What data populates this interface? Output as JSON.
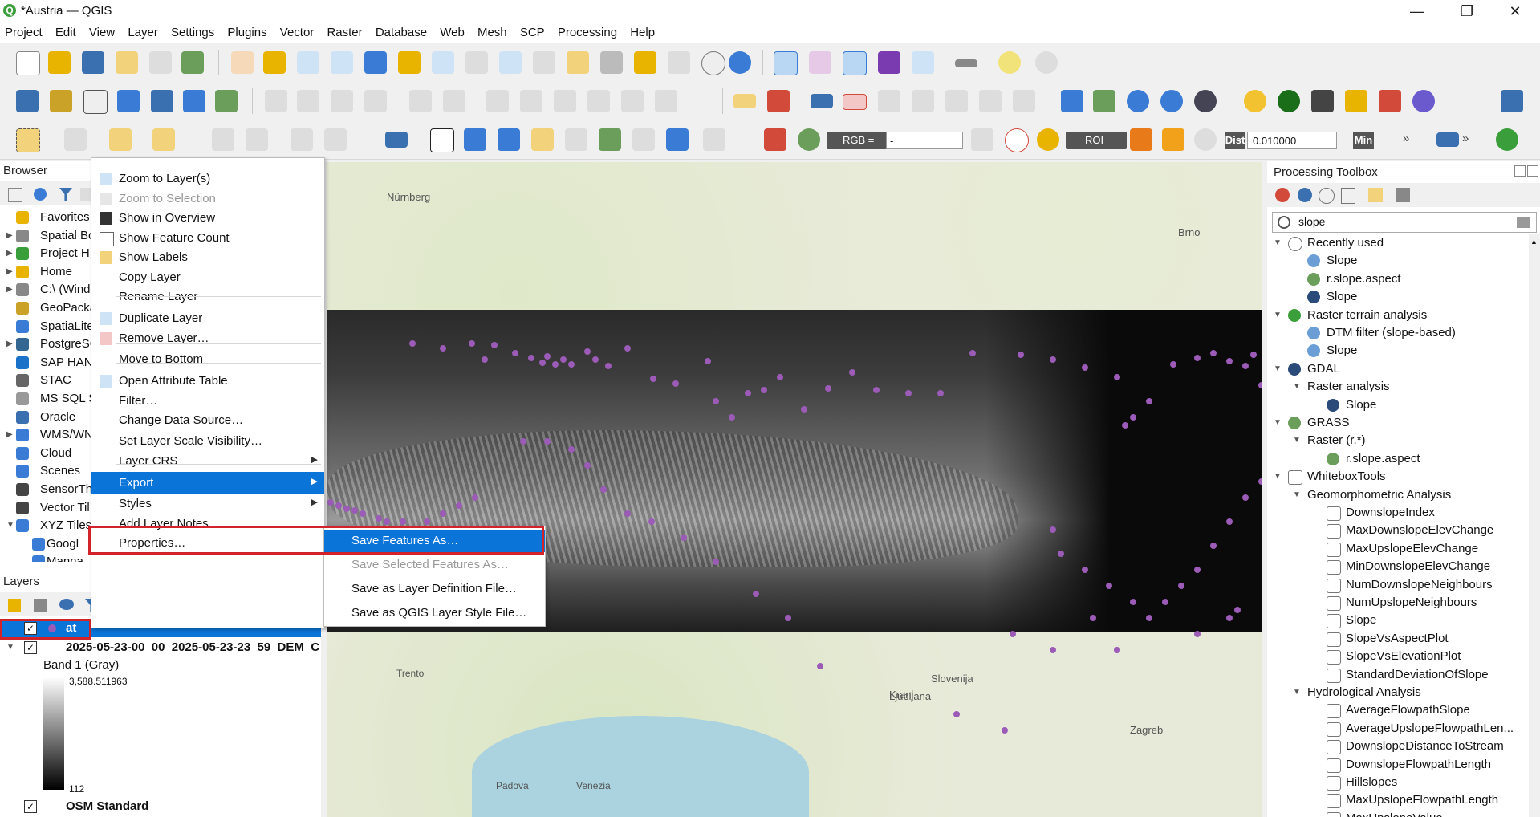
{
  "window": {
    "title": "*Austria — QGIS",
    "logo_letter": "Q",
    "minimize": "—",
    "maximize": "❐",
    "close": "✕"
  },
  "menubar": [
    "Project",
    "Edit",
    "View",
    "Layer",
    "Settings",
    "Plugins",
    "Vector",
    "Raster",
    "Database",
    "Web",
    "Mesh",
    "SCP",
    "Processing",
    "Help"
  ],
  "toolbar3": {
    "rgb_label": "RGB =",
    "rgb_value": "-",
    "roi_label": "ROI",
    "dist_label": "Dist",
    "dist_value": "0.010000",
    "min_label": "Min",
    "overflow": "»"
  },
  "browser": {
    "title": "Browser",
    "items": [
      {
        "label": "Favorites",
        "icon": "star-icon",
        "color": "#e8b400"
      },
      {
        "label": "Spatial Bo",
        "icon": "spatial-bookmarks-icon",
        "color": "#888"
      },
      {
        "label": "Project H",
        "icon": "project-home-icon",
        "color": "#3a9e3a"
      },
      {
        "label": "Home",
        "icon": "home-folder-icon",
        "color": "#e8b400"
      },
      {
        "label": "C:\\ (Wind",
        "icon": "drive-icon",
        "color": "#888"
      },
      {
        "label": "GeoPacka",
        "icon": "geopackage-icon",
        "color": "#c9a227"
      },
      {
        "label": "SpatiaLite",
        "icon": "spatialite-icon",
        "color": "#3a7bd5"
      },
      {
        "label": "PostgreSC",
        "icon": "postgresql-icon",
        "color": "#336791"
      },
      {
        "label": "SAP HAN",
        "icon": "sap-hana-icon",
        "color": "#1a73c9"
      },
      {
        "label": "STAC",
        "icon": "stac-icon",
        "color": "#666"
      },
      {
        "label": "MS SQL S",
        "icon": "mssql-icon",
        "color": "#999"
      },
      {
        "label": "Oracle",
        "icon": "oracle-icon",
        "color": "#3a6fb0"
      },
      {
        "label": "WMS/WN",
        "icon": "wms-globe-icon",
        "color": "#3a7bd5"
      },
      {
        "label": "Cloud",
        "icon": "cloud-icon",
        "color": "#3a7bd5"
      },
      {
        "label": "Scenes",
        "icon": "scenes-icon",
        "color": "#3a7bd5"
      },
      {
        "label": "SensorTh",
        "icon": "sensor-icon",
        "color": "#444"
      },
      {
        "label": "Vector Til",
        "icon": "vector-tiles-icon",
        "color": "#444"
      },
      {
        "label": "XYZ Tiles",
        "icon": "xyz-tiles-icon",
        "color": "#3a7bd5"
      },
      {
        "label": "Googl",
        "icon": "google-tiles-icon",
        "color": "#3a7bd5"
      },
      {
        "label": "Manna",
        "icon": "tiles-icon",
        "color": "#3a7bd5"
      }
    ]
  },
  "layers": {
    "title": "Layers",
    "items": [
      {
        "name": "at",
        "checked": true,
        "selected": true
      },
      {
        "name": "2025-05-23-00_00_2025-05-23-23_59_DEM_C",
        "checked": true,
        "selected": false
      },
      {
        "name": "OSM Standard",
        "checked": true,
        "selected": false
      }
    ],
    "band_label": "Band 1 (Gray)",
    "legend_max": "3,588.511963",
    "legend_min": "112"
  },
  "context_menu": {
    "items": [
      {
        "label": "Zoom to Layer(s)",
        "icon": "zoom-layer-icon",
        "disabled": false
      },
      {
        "label": "Zoom to Selection",
        "icon": "zoom-selection-icon",
        "disabled": true
      },
      {
        "label": "Show in Overview",
        "icon": "overview-icon",
        "disabled": false
      },
      {
        "label": "Show Feature Count",
        "icon": "checkbox-icon",
        "disabled": false
      },
      {
        "label": "Show Labels",
        "icon": "labels-icon",
        "disabled": false
      },
      {
        "label": "Copy Layer",
        "icon": "",
        "disabled": false
      },
      {
        "label": "Rename Layer",
        "icon": "",
        "disabled": false
      },
      {
        "label": "Duplicate Layer",
        "icon": "duplicate-icon",
        "disabled": false
      },
      {
        "label": "Remove Layer…",
        "icon": "remove-layer-icon",
        "disabled": false
      },
      {
        "label": "Move to Bottom",
        "icon": "",
        "disabled": false
      },
      {
        "label": "Open Attribute Table",
        "icon": "table-icon",
        "disabled": false
      },
      {
        "label": "Filter…",
        "icon": "",
        "disabled": false
      },
      {
        "label": "Change Data Source…",
        "icon": "",
        "disabled": false
      },
      {
        "label": "Set Layer Scale Visibility…",
        "icon": "",
        "disabled": false
      },
      {
        "label": "Layer CRS",
        "icon": "",
        "disabled": false,
        "submenu": true
      },
      {
        "label": "Export",
        "icon": "",
        "disabled": false,
        "submenu": true,
        "highlighted": true
      },
      {
        "label": "Styles",
        "icon": "",
        "disabled": false,
        "submenu": true
      },
      {
        "label": "Add Layer Notes…",
        "icon": "",
        "disabled": false
      },
      {
        "label": "Properties…",
        "icon": "",
        "disabled": false
      }
    ],
    "arrow": "▶"
  },
  "export_submenu": {
    "items": [
      {
        "label": "Save Features As…",
        "disabled": false,
        "highlighted": true
      },
      {
        "label": "Save Selected Features As…",
        "disabled": true
      },
      {
        "label": "Save as Layer Definition File…",
        "disabled": false
      },
      {
        "label": "Save as QGIS Layer Style File…",
        "disabled": false
      }
    ]
  },
  "map_labels": {
    "nurnberg": "Nürnberg",
    "brno": "Brno",
    "ljubljana": "Ljubljana",
    "slovenija": "Slovenija",
    "zagreb": "Zagreb",
    "venezia": "Venezia",
    "trento": "Trento",
    "padova": "Padova",
    "kranj": "Kranj"
  },
  "toolbox": {
    "title": "Processing Toolbox",
    "search_value": "slope",
    "clear_icon": "clear-search-icon",
    "tree": [
      {
        "label": "Recently used",
        "level": 0,
        "kind": "group",
        "icon": "clock-icon"
      },
      {
        "label": "Slope",
        "level": 1,
        "kind": "alg",
        "icon": "gear-icon"
      },
      {
        "label": "r.slope.aspect",
        "level": 1,
        "kind": "alg",
        "icon": "grass-icon"
      },
      {
        "label": "Slope",
        "level": 1,
        "kind": "alg",
        "icon": "gdal-icon"
      },
      {
        "label": "Raster terrain analysis",
        "level": 0,
        "kind": "group",
        "icon": "qgis-icon"
      },
      {
        "label": "DTM filter (slope-based)",
        "level": 1,
        "kind": "alg",
        "icon": "gear-icon"
      },
      {
        "label": "Slope",
        "level": 1,
        "kind": "alg",
        "icon": "gear-icon"
      },
      {
        "label": "GDAL",
        "level": 0,
        "kind": "group",
        "icon": "gdal-icon"
      },
      {
        "label": "Raster analysis",
        "level": 1,
        "kind": "group",
        "icon": ""
      },
      {
        "label": "Slope",
        "level": 2,
        "kind": "alg",
        "icon": "gdal-icon"
      },
      {
        "label": "GRASS",
        "level": 0,
        "kind": "group",
        "icon": "grass-icon"
      },
      {
        "label": "Raster (r.*)",
        "level": 1,
        "kind": "group",
        "icon": ""
      },
      {
        "label": "r.slope.aspect",
        "level": 2,
        "kind": "alg",
        "icon": "grass-icon"
      },
      {
        "label": "WhiteboxTools",
        "level": 0,
        "kind": "group",
        "icon": "whitebox-icon"
      },
      {
        "label": "Geomorphometric Analysis",
        "level": 1,
        "kind": "group",
        "icon": ""
      },
      {
        "label": "DownslopeIndex",
        "level": 2,
        "kind": "alg",
        "icon": "whitebox-icon"
      },
      {
        "label": "MaxDownslopeElevChange",
        "level": 2,
        "kind": "alg",
        "icon": "whitebox-icon"
      },
      {
        "label": "MaxUpslopeElevChange",
        "level": 2,
        "kind": "alg",
        "icon": "whitebox-icon"
      },
      {
        "label": "MinDownslopeElevChange",
        "level": 2,
        "kind": "alg",
        "icon": "whitebox-icon"
      },
      {
        "label": "NumDownslopeNeighbours",
        "level": 2,
        "kind": "alg",
        "icon": "whitebox-icon"
      },
      {
        "label": "NumUpslopeNeighbours",
        "level": 2,
        "kind": "alg",
        "icon": "whitebox-icon"
      },
      {
        "label": "Slope",
        "level": 2,
        "kind": "alg",
        "icon": "whitebox-icon"
      },
      {
        "label": "SlopeVsAspectPlot",
        "level": 2,
        "kind": "alg",
        "icon": "whitebox-icon"
      },
      {
        "label": "SlopeVsElevationPlot",
        "level": 2,
        "kind": "alg",
        "icon": "whitebox-icon"
      },
      {
        "label": "StandardDeviationOfSlope",
        "level": 2,
        "kind": "alg",
        "icon": "whitebox-icon"
      },
      {
        "label": "Hydrological Analysis",
        "level": 1,
        "kind": "group",
        "icon": ""
      },
      {
        "label": "AverageFlowpathSlope",
        "level": 2,
        "kind": "alg",
        "icon": "whitebox-icon"
      },
      {
        "label": "AverageUpslopeFlowpathLen...",
        "level": 2,
        "kind": "alg",
        "icon": "whitebox-icon"
      },
      {
        "label": "DownslopeDistanceToStream",
        "level": 2,
        "kind": "alg",
        "icon": "whitebox-icon"
      },
      {
        "label": "DownslopeFlowpathLength",
        "level": 2,
        "kind": "alg",
        "icon": "whitebox-icon"
      },
      {
        "label": "Hillslopes",
        "level": 2,
        "kind": "alg",
        "icon": "whitebox-icon"
      },
      {
        "label": "MaxUpslopeFlowpathLength",
        "level": 2,
        "kind": "alg",
        "icon": "whitebox-icon"
      },
      {
        "label": "MaxUpslopeValue",
        "level": 2,
        "kind": "alg",
        "icon": "whitebox-icon"
      }
    ]
  },
  "colors": {
    "highlight": "#0a74d8",
    "annotation_red": "#d2232a",
    "point": "#9b5bb7"
  }
}
